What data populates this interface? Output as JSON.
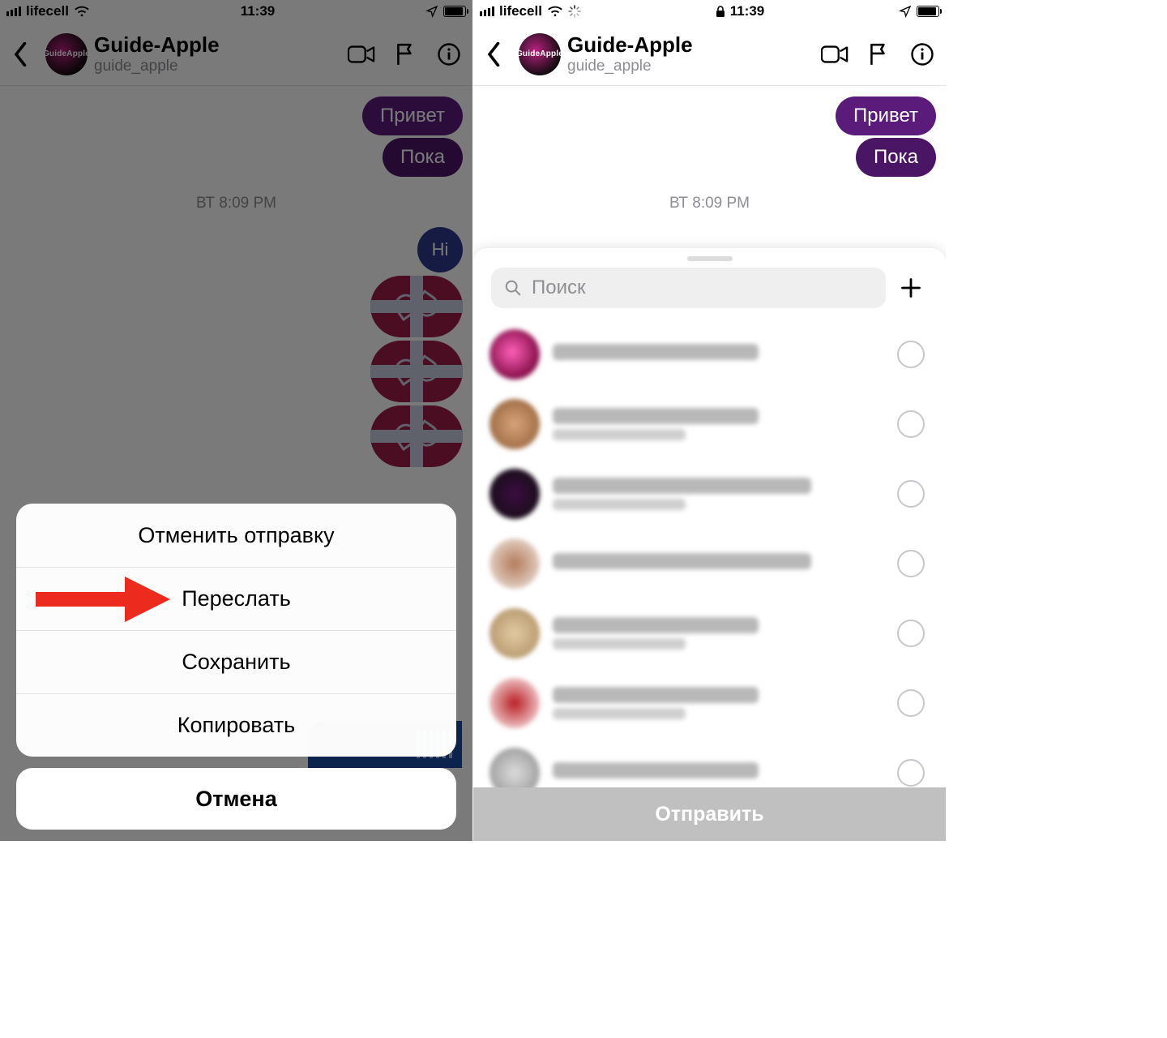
{
  "status": {
    "carrier": "lifecell",
    "time": "11:39"
  },
  "chat": {
    "name": "Guide-Apple",
    "username": "guide_apple",
    "messages": {
      "m1": "Привет",
      "m2": "Пока",
      "m3": "Hi"
    },
    "timestamp": "ВТ 8:09 PM"
  },
  "sheet": {
    "unsend": "Отменить отправку",
    "forward": "Переслать",
    "save": "Сохранить",
    "copy": "Копировать",
    "cancel": "Отмена"
  },
  "forward": {
    "search_placeholder": "Поиск",
    "send": "Отправить"
  }
}
